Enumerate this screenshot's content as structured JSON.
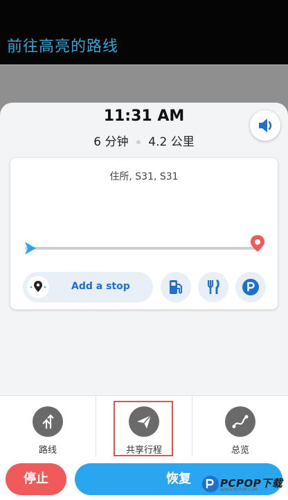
{
  "header": {
    "title": "前往高亮的路线"
  },
  "eta": {
    "time": "11:31 AM",
    "duration": "6 分钟",
    "distance": "4.2 公里"
  },
  "route_card": {
    "address": "住所, S31, S31",
    "add_stop_label": "Add a stop"
  },
  "options": [
    {
      "label": "路线",
      "icon": "route-icon"
    },
    {
      "label": "共享行程",
      "icon": "share-send-icon"
    },
    {
      "label": "总览",
      "icon": "overview-icon"
    }
  ],
  "actions": {
    "stop_label": "停止",
    "resume_label": "恢复"
  },
  "watermark": {
    "text": "PCPOP下载",
    "subtext": "WWW.PCPOP.COM"
  },
  "colors": {
    "title": "#33a8d6",
    "accent_blue": "#1e6fd0",
    "stop_red": "#f05a5a",
    "resume_blue": "#2aa5f0",
    "highlight": "#e0524f"
  }
}
